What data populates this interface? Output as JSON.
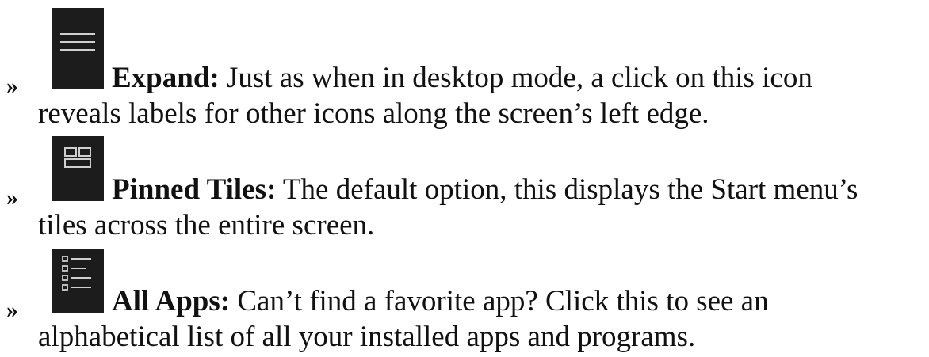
{
  "bullet_symbol": "»",
  "items": [
    {
      "icon": "hamburger-menu-icon",
      "term": "Expand:",
      "line1": " Just as when in desktop mode, a click on this icon",
      "line2": "reveals labels for other icons along the screen’s left edge."
    },
    {
      "icon": "pinned-tiles-icon",
      "term": "Pinned Tiles:",
      "line1": " The default option, this displays the Start menu’s",
      "line2": "tiles across the entire screen."
    },
    {
      "icon": "all-apps-list-icon",
      "term": "All Apps:",
      "line1": " Can’t find a favorite app? Click this to see an",
      "line2": "alphabetical list of all your installed apps and programs."
    }
  ],
  "colors": {
    "icon_background": "#1c1c1c",
    "icon_stroke": "#cfcfcf",
    "text": "#111111"
  }
}
